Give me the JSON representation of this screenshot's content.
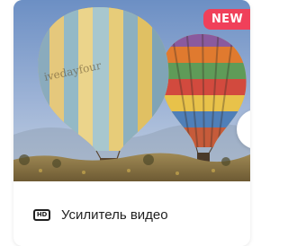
{
  "card": {
    "badge": "NEW",
    "icon": "hd-icon",
    "icon_text": "HD",
    "title": "Усилитель видео",
    "image": "hot-air-balloons-photo"
  },
  "colors": {
    "badge_bg": "#f0405a",
    "text": "#1f1f1f",
    "card_bg": "#ffffff"
  }
}
